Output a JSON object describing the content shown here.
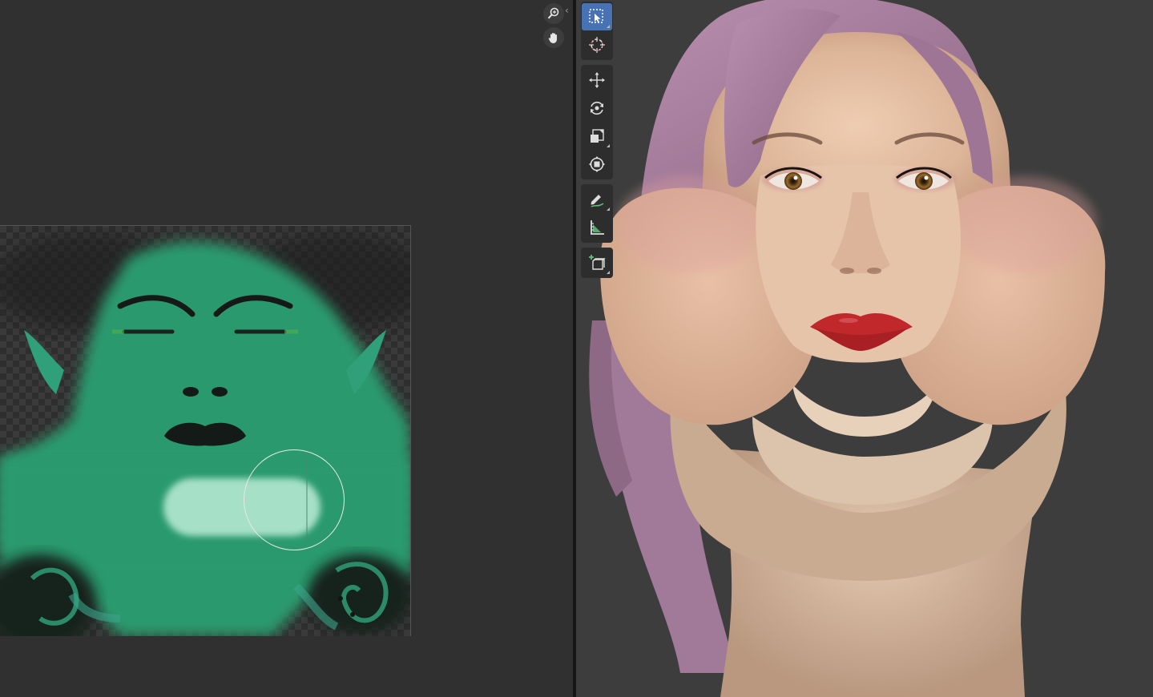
{
  "image_editor": {
    "nav": [
      {
        "icon": "zoom-icon",
        "glyph": "⚲"
      },
      {
        "icon": "hand-pan-icon",
        "glyph": "✋"
      }
    ],
    "collapse_glyph": "‹"
  },
  "toolbar": {
    "groups": [
      [
        {
          "icon": "select-box-icon",
          "active": true
        },
        {
          "icon": "cursor-3d-icon",
          "active": false
        }
      ],
      [
        {
          "icon": "move-icon"
        },
        {
          "icon": "rotate-icon"
        },
        {
          "icon": "scale-icon"
        },
        {
          "icon": "transform-icon"
        }
      ],
      [
        {
          "icon": "annotate-icon"
        },
        {
          "icon": "measure-icon"
        }
      ],
      [
        {
          "icon": "add-cube-icon"
        }
      ]
    ],
    "active_color": "#4772b3"
  },
  "colors": {
    "texture_green": "#2a9a6e",
    "skin": "#e0bba0",
    "hair": "#b88aa8",
    "lips": "#c0282c",
    "background": "#3d3d3d"
  }
}
